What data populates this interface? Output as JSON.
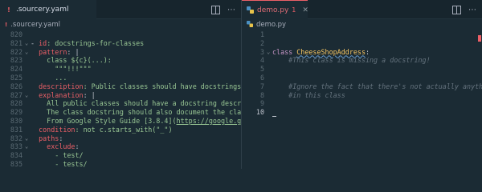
{
  "left": {
    "tab": {
      "label": ".sourcery.yaml",
      "icon": "exclamation-icon"
    },
    "breadcrumb": ".sourcery.yaml",
    "lines": [
      {
        "n": "820",
        "segments": []
      },
      {
        "n": "821",
        "segments": [
          [
            "- ",
            "dash"
          ],
          [
            "id",
            "key"
          ],
          [
            ": docstrings-for-classes",
            "str"
          ]
        ]
      },
      {
        "n": "822",
        "segments": [
          [
            "  ",
            "punc"
          ],
          [
            "pattern",
            "key"
          ],
          [
            ": |",
            "punc"
          ]
        ]
      },
      {
        "n": "823",
        "segments": [
          [
            "    class ${c}(...):",
            "str"
          ]
        ]
      },
      {
        "n": "824",
        "segments": [
          [
            "      \"\"\"!!!\"\"\"",
            "str"
          ]
        ]
      },
      {
        "n": "825",
        "segments": [
          [
            "      ...",
            "str"
          ]
        ]
      },
      {
        "n": "826",
        "segments": [
          [
            "  ",
            "punc"
          ],
          [
            "description",
            "key"
          ],
          [
            ": Public classes should have docstrings",
            "str"
          ]
        ]
      },
      {
        "n": "827",
        "segments": [
          [
            "  ",
            "punc"
          ],
          [
            "explanation",
            "key"
          ],
          [
            ": |",
            "punc"
          ]
        ]
      },
      {
        "n": "828",
        "segments": [
          [
            "    All public classes should have a docstring describing th",
            "str"
          ]
        ]
      },
      {
        "n": "829",
        "segments": [
          [
            "    The class docstring should also document the class' publ",
            "str"
          ]
        ]
      },
      {
        "n": "830",
        "segments": [
          [
            "    From Google Style Guide [3.8.4](",
            "str"
          ],
          [
            "https://google.github.io",
            "link"
          ]
        ]
      },
      {
        "n": "831",
        "segments": [
          [
            "  ",
            "punc"
          ],
          [
            "condition",
            "key"
          ],
          [
            ": not c.starts_with(\"_\")",
            "str"
          ]
        ]
      },
      {
        "n": "832",
        "segments": [
          [
            "  ",
            "punc"
          ],
          [
            "paths",
            "key"
          ],
          [
            ":",
            "punc"
          ]
        ]
      },
      {
        "n": "833",
        "segments": [
          [
            "    ",
            "punc"
          ],
          [
            "exclude",
            "key"
          ],
          [
            ":",
            "punc"
          ]
        ]
      },
      {
        "n": "834",
        "segments": [
          [
            "      - test/",
            "str"
          ]
        ]
      },
      {
        "n": "835",
        "segments": [
          [
            "      - tests/",
            "str"
          ]
        ]
      }
    ]
  },
  "right": {
    "tab": {
      "label": "demo.py",
      "dirty_count": "1"
    },
    "breadcrumb": "demo.py",
    "lines": [
      {
        "n": "1",
        "segments": []
      },
      {
        "n": "2",
        "segments": []
      },
      {
        "n": "3",
        "segments": [
          [
            "class ",
            "kw"
          ],
          [
            "CheeseShopAddress",
            "cls"
          ],
          [
            ":",
            "punc"
          ]
        ]
      },
      {
        "n": "4",
        "segments": [
          [
            "    #This class is missing a docstring!",
            "cmt"
          ]
        ]
      },
      {
        "n": "5",
        "segments": []
      },
      {
        "n": "6",
        "segments": []
      },
      {
        "n": "7",
        "segments": [
          [
            "    #Ignore the fact that there's not actually anything",
            "cmt"
          ]
        ]
      },
      {
        "n": "8",
        "segments": [
          [
            "    #in this class",
            "cmt"
          ]
        ]
      },
      {
        "n": "9",
        "segments": []
      },
      {
        "n": "10",
        "segments": [],
        "cursor": true
      }
    ]
  },
  "colors": {
    "accent": "#ec5f67",
    "background": "#1b2b34"
  }
}
